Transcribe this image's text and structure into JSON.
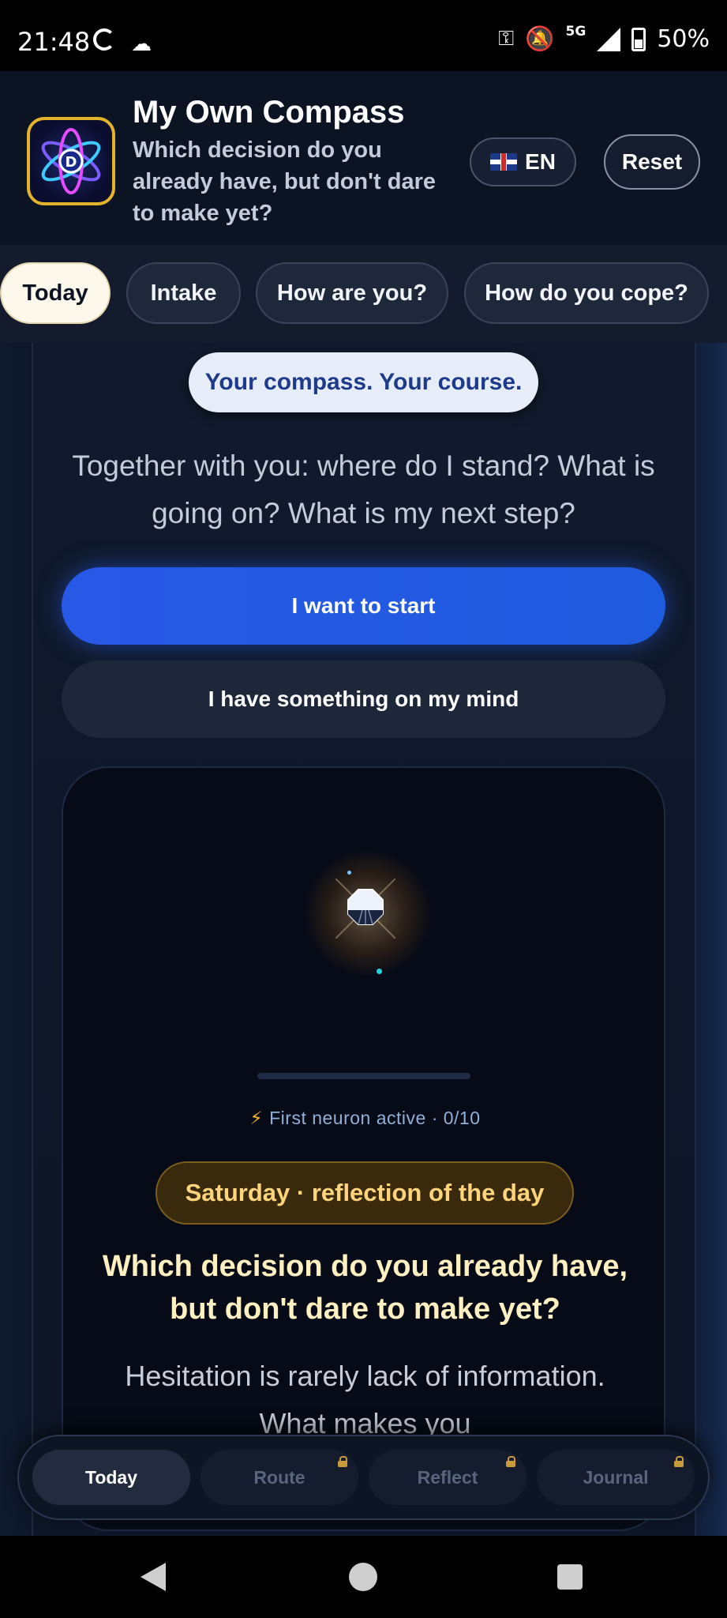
{
  "status_bar": {
    "time": "21:48",
    "network": "5G",
    "battery": "50%"
  },
  "header": {
    "title": "My Own Compass",
    "subtitle": "Which decision do you already have, but don't dare to make yet?",
    "language_label": "EN",
    "reset_label": "Reset"
  },
  "tabs": [
    {
      "label": "Today",
      "active": true
    },
    {
      "label": "Intake",
      "active": false
    },
    {
      "label": "How are you?",
      "active": false
    },
    {
      "label": "How do you cope?",
      "active": false
    }
  ],
  "main": {
    "motto": "Your compass. Your course.",
    "intro": "Together with you: where do I stand? What is going on? What is my next step?",
    "start_button": "I want to start",
    "mind_button": "I have something on my mind"
  },
  "neuron": {
    "status": "First neuron active · 0/10",
    "progress": 0,
    "progress_total": 10,
    "day_label": "Saturday · reflection of the day",
    "question": "Which decision do you already have, but don't dare to make yet?",
    "body": "Hesitation is rarely lack of information. What makes you"
  },
  "bottom_nav": [
    {
      "label": "Today",
      "active": true,
      "locked": false
    },
    {
      "label": "Route",
      "active": false,
      "locked": true
    },
    {
      "label": "Reflect",
      "active": false,
      "locked": true
    },
    {
      "label": "Journal",
      "active": false,
      "locked": true
    }
  ],
  "colors": {
    "accent_blue": "#2858e6",
    "gold": "#e3b32a",
    "background": "#0b1322"
  }
}
